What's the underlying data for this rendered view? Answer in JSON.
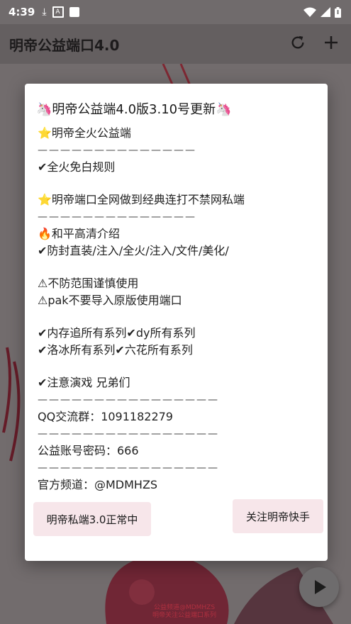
{
  "status_bar": {
    "time": "4:39"
  },
  "app_bar": {
    "title": "明帝公益端口4.0"
  },
  "dialog": {
    "title": "🦄明帝公益端4.0版3.10号更新🦄",
    "lines": [
      "⭐明帝全火公益端",
      "——————————————",
      "✔全火免白规则",
      "",
      "⭐明帝端口全网做到经典连打不禁网私端",
      "——————————————",
      "🔥和平高清介绍",
      "✔防封直装/注入/全火/注入/文件/美化/",
      "",
      "⚠不防范围谨慎使用",
      "⚠pak不要导入原版使用端口",
      "",
      "✔内存追所有系列✔dy所有系列",
      "✔洛冰所有系列✔六花所有系列",
      "",
      "✔注意演戏 兄弟们",
      "————————————————",
      "QQ交流群：1091182279",
      "————————————————",
      "公益账号密码：666",
      "————————————————",
      "官方频道：@MDMHZS"
    ],
    "button_left": "明帝私端3.0正常中",
    "button_right": "关注明帝快手"
  },
  "bottom_caption": [
    "公益频道@MDMHZS",
    "明帝关注公益端口系列"
  ],
  "colors": {
    "app_bar": "#645f60",
    "button_bg": "#f7e6ea",
    "dialog_bg": "#ffffff"
  }
}
